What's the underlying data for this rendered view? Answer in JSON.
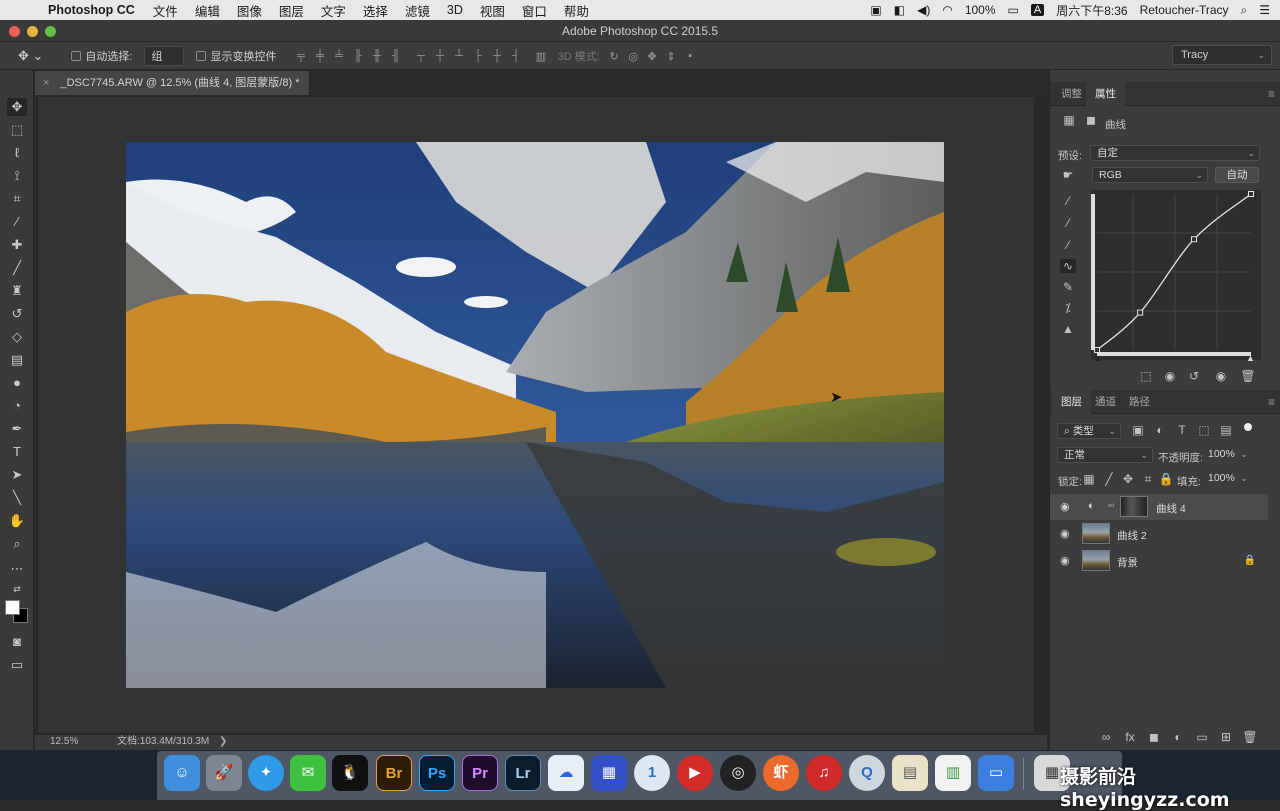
{
  "menubar": {
    "app_name": "Photoshop CC",
    "items": [
      "文件",
      "编辑",
      "图像",
      "图层",
      "文字",
      "选择",
      "滤镜",
      "3D",
      "视图",
      "窗口",
      "帮助"
    ],
    "battery": "100%",
    "input_method": "A",
    "clock": "周六下午8:36",
    "user": "Retoucher-Tracy"
  },
  "window": {
    "title": "Adobe Photoshop CC 2015.5"
  },
  "options": {
    "auto_select_label": "自动选择:",
    "auto_select_value": "组",
    "transform_controls_label": "显示变换控件",
    "mode_3d": "3D 模式:",
    "workspace": "Tracy"
  },
  "document": {
    "tab_title": "_DSC7745.ARW @ 12.5% (曲线 4, 图层蒙版/8) *",
    "zoom": "12.5%",
    "doc_size": "文档:103.4M/310.3M"
  },
  "properties_panel": {
    "tabs": [
      "调整",
      "属性"
    ],
    "active_tab": "属性",
    "adjustment_name": "曲线",
    "preset_label": "预设:",
    "preset_value": "自定",
    "channel_value": "RGB",
    "auto_button": "自动",
    "curve_points": [
      [
        0,
        0
      ],
      [
        0.28,
        0.24
      ],
      [
        0.63,
        0.71
      ],
      [
        1,
        1
      ]
    ]
  },
  "layers_panel": {
    "tabs": [
      "图层",
      "通道",
      "路径"
    ],
    "active_tab": "图层",
    "filter_kind": "类型",
    "blend_mode": "正常",
    "opacity_label": "不透明度:",
    "opacity_value": "100%",
    "lock_label": "锁定:",
    "fill_label": "填充:",
    "fill_value": "100%",
    "layers": [
      {
        "name": "曲线 4",
        "active": true,
        "locked": false
      },
      {
        "name": "曲线 2",
        "active": false,
        "locked": false
      },
      {
        "name": "背景",
        "active": false,
        "locked": true
      }
    ]
  },
  "dock": {
    "apps": [
      "Finder",
      "Launchpad",
      "Safari",
      "WeChat",
      "QQ",
      "Br",
      "Ps",
      "Pr",
      "Lr",
      "Baidu",
      "App",
      "1Password",
      "Player",
      "OBS",
      "Xia",
      "NetEase",
      "QuickTime",
      "Preview",
      "Numbers",
      "Keynote"
    ]
  },
  "watermark": "摄影前沿 sheyingyzz.com",
  "colors": {
    "ui_dark": "#282828",
    "panel": "#3c3c3c",
    "accent_ps": "#31a8ff"
  }
}
